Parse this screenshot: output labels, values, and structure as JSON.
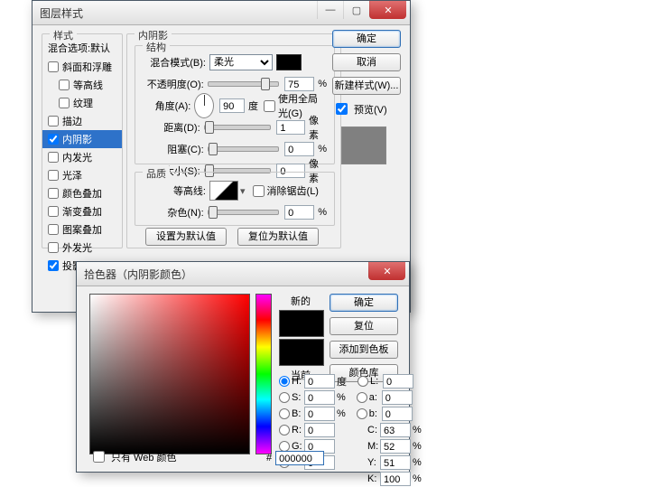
{
  "win1": {
    "title": "图层样式",
    "styles_header": "样式",
    "blend_default": "混合选项:默认",
    "items": [
      {
        "label": "斜面和浮雕",
        "checked": false
      },
      {
        "label": "等高线",
        "checked": false,
        "indent": true
      },
      {
        "label": "纹理",
        "checked": false,
        "indent": true
      },
      {
        "label": "描边",
        "checked": false
      },
      {
        "label": "内阴影",
        "checked": true,
        "selected": true
      },
      {
        "label": "内发光",
        "checked": false
      },
      {
        "label": "光泽",
        "checked": false
      },
      {
        "label": "颜色叠加",
        "checked": false
      },
      {
        "label": "渐变叠加",
        "checked": false
      },
      {
        "label": "图案叠加",
        "checked": false
      },
      {
        "label": "外发光",
        "checked": false
      },
      {
        "label": "投影",
        "checked": true
      }
    ],
    "panel_title": "内阴影",
    "structure_label": "结构",
    "blend_mode_label": "混合模式(B):",
    "blend_mode_value": "柔光",
    "opacity_label": "不透明度(O):",
    "opacity_value": "75",
    "angle_label": "角度(A):",
    "angle_value": "90",
    "angle_unit": "度",
    "global_light_label": "使用全局光(G)",
    "distance_label": "距离(D):",
    "distance_value": "1",
    "choke_label": "阻塞(C):",
    "choke_value": "0",
    "size_label": "大小(S):",
    "size_value": "0",
    "px_unit": "像素",
    "pct_unit": "%",
    "quality_label": "品质",
    "contour_label": "等高线:",
    "antialias_label": "消除锯齿(L)",
    "noise_label": "杂色(N):",
    "noise_value": "0",
    "btn_make_default": "设置为默认值",
    "btn_reset_default": "复位为默认值",
    "ok": "确定",
    "cancel": "取消",
    "new_style": "新建样式(W)...",
    "preview_label": "预览(V)"
  },
  "win2": {
    "title": "拾色器（内阴影颜色）",
    "new_label": "新的",
    "current_label": "当前",
    "ok": "确定",
    "reset": "复位",
    "add_swatch": "添加到色板",
    "color_libs": "颜色库",
    "H_label": "H:",
    "H_val": "0",
    "H_unit": "度",
    "S_label": "S:",
    "S_val": "0",
    "S_unit": "%",
    "Bv_label": "B:",
    "Bv_val": "0",
    "Bv_unit": "%",
    "L_label": "L:",
    "L_val": "0",
    "a_label": "a:",
    "a_val": "0",
    "b2_label": "b:",
    "b2_val": "0",
    "R_label": "R:",
    "R_val": "0",
    "G_label": "G:",
    "G_val": "0",
    "B_label": "B:",
    "B_val": "0",
    "C_label": "C:",
    "C_val": "63",
    "M_label": "M:",
    "M_val": "52",
    "Y_label": "Y:",
    "Y_val": "51",
    "K_label": "K:",
    "K_val": "100",
    "pct": "%",
    "web_only": "只有 Web 颜色",
    "hash": "#",
    "hex": "000000"
  }
}
